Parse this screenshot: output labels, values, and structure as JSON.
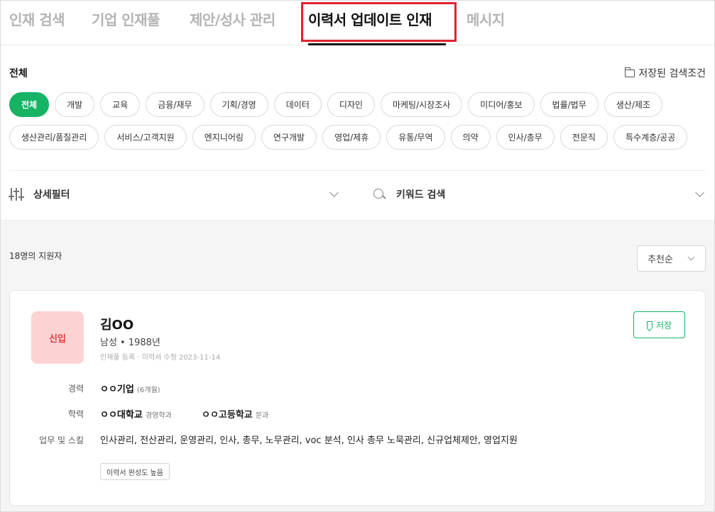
{
  "tabs": [
    {
      "label": "인재 검색"
    },
    {
      "label": "기업 인재풀"
    },
    {
      "label": "제안/성사 관리"
    },
    {
      "label": "이력서 업데이트 인재"
    },
    {
      "label": "메시지"
    }
  ],
  "active_tab": "이력서 업데이트 인재",
  "accent_color": "#16b364",
  "highlight_color": "#e0232d",
  "filter": {
    "section_title": "전체",
    "saved_search_label": "저장된 검색조건",
    "categories_row1": [
      "전체",
      "개발",
      "교육",
      "금융/재무",
      "기획/경영",
      "데이터",
      "디자인",
      "마케팅/시장조사",
      "미디어/홍보",
      "법률/법무",
      "생산/제조"
    ],
    "categories_row2": [
      "생산관리/품질관리",
      "서비스/고객지원",
      "엔지니어링",
      "연구개발",
      "영업/제휴",
      "유통/무역",
      "의약",
      "인사/총무",
      "전문직",
      "특수계층/공공"
    ],
    "selected_category": "전체",
    "detail_filter_label": "상세필터",
    "keyword_search_label": "키워드 검색"
  },
  "results": {
    "count_label": "18명의 지원자",
    "sort_label": "추천순"
  },
  "candidate": {
    "badge": "신입",
    "name": "김OO",
    "meta": "남성 • 1988년",
    "meta_sub": "인재풀 등록 · 이력서 수정 2023-11-14",
    "save_label": "저장",
    "career_label": "경력",
    "career_company": "ㅇㅇ기업",
    "career_duration": "(6개월)",
    "education_label": "학력",
    "education_school1": "ㅇㅇ대학교",
    "education_major1": "경영학과",
    "education_school2": "ㅇㅇ고등학교",
    "education_major2": "문과",
    "skills_label": "업무 및 스킬",
    "skills": "인사관리, 전산관리, 운영관리, 인사, 총무, 노무관리, voc 분석, 인사 총무 노묵관리, 신규업체제안, 영업지원",
    "completeness_tag": "이력서 완성도 높음"
  }
}
